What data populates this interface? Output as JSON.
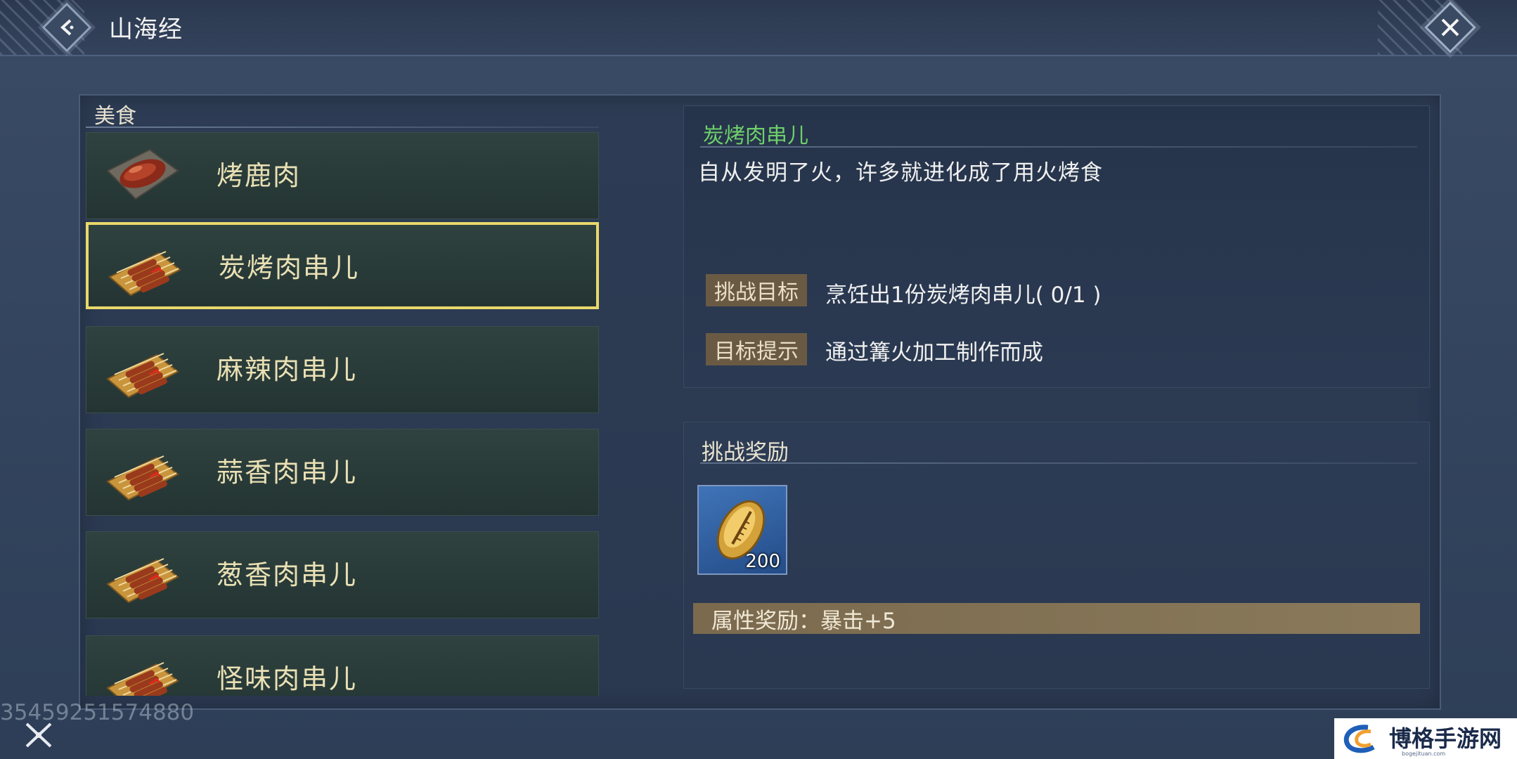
{
  "header": {
    "title": "山海经"
  },
  "category": {
    "label": "美食"
  },
  "food_list": [
    {
      "name": "烤鹿肉",
      "icon": "roast-venison-icon",
      "selected": false
    },
    {
      "name": "炭烤肉串儿",
      "icon": "skewer-icon",
      "selected": true
    },
    {
      "name": "麻辣肉串儿",
      "icon": "skewer-icon",
      "selected": false
    },
    {
      "name": "蒜香肉串儿",
      "icon": "skewer-icon",
      "selected": false
    },
    {
      "name": "葱香肉串儿",
      "icon": "skewer-icon",
      "selected": false
    },
    {
      "name": "怪味肉串儿",
      "icon": "skewer-icon",
      "selected": false
    }
  ],
  "detail": {
    "title": "炭烤肉串儿",
    "description": "自从发明了火，许多就进化成了用火烤食",
    "challenge_goal_label": "挑战目标",
    "challenge_goal_value": "烹饪出1份炭烤肉串儿( 0/1 )",
    "goal_hint_label": "目标提示",
    "goal_hint_value": "通过篝火加工制作而成"
  },
  "rewards": {
    "title": "挑战奖励",
    "item_icon": "gold-shell-icon",
    "item_count": "200",
    "attribute_bonus": "属性奖励：暴击+5"
  },
  "footer": {
    "user_id": "35459251574880"
  },
  "watermark": {
    "text": "博格手游网",
    "sub": "bogejituan.com"
  },
  "colors": {
    "selected_border": "#e8d86a",
    "detail_title": "#6fcf6a",
    "item_name": "#e9e0b4",
    "tag_bg": "#6a5a44",
    "attr_bar": "#7b6a4e"
  }
}
